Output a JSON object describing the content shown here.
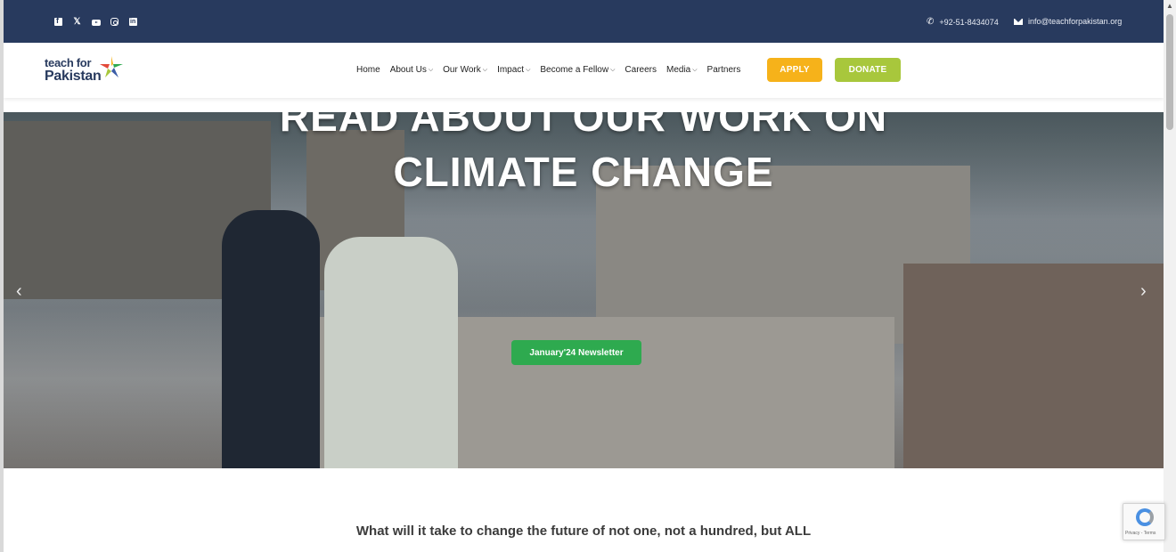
{
  "topbar": {
    "social": [
      "facebook-icon",
      "x-icon",
      "youtube-icon",
      "instagram-icon",
      "linkedin-icon"
    ],
    "phone": "+92-51-8434074",
    "email": "info@teachforpakistan.org"
  },
  "brand": {
    "line1": "teach for",
    "line2": "Pakistan"
  },
  "nav": {
    "items": [
      {
        "label": "Home",
        "dropdown": false
      },
      {
        "label": "About Us",
        "dropdown": true
      },
      {
        "label": "Our Work",
        "dropdown": true
      },
      {
        "label": "Impact",
        "dropdown": true
      },
      {
        "label": "Become a Fellow",
        "dropdown": true
      },
      {
        "label": "Careers",
        "dropdown": false
      },
      {
        "label": "Media",
        "dropdown": true
      },
      {
        "label": "Partners",
        "dropdown": false
      }
    ],
    "apply_label": "APPLY",
    "donate_label": "DONATE"
  },
  "hero": {
    "title_line1": "READ ABOUT OUR WORK ON",
    "title_line2": "CLIMATE CHANGE",
    "cta_label": "January'24 Newsletter",
    "prev_icon": "chevron-left-icon",
    "next_icon": "chevron-right-icon"
  },
  "intro": {
    "heading": "What will it take to change the future of not one, not a hundred, but ALL"
  },
  "recaptcha": {
    "text": "Privacy - Terms"
  },
  "colors": {
    "topbar": "#283a5e",
    "apply": "#f6b21a",
    "donate": "#a8c73c",
    "cta": "#2eaa4f"
  }
}
